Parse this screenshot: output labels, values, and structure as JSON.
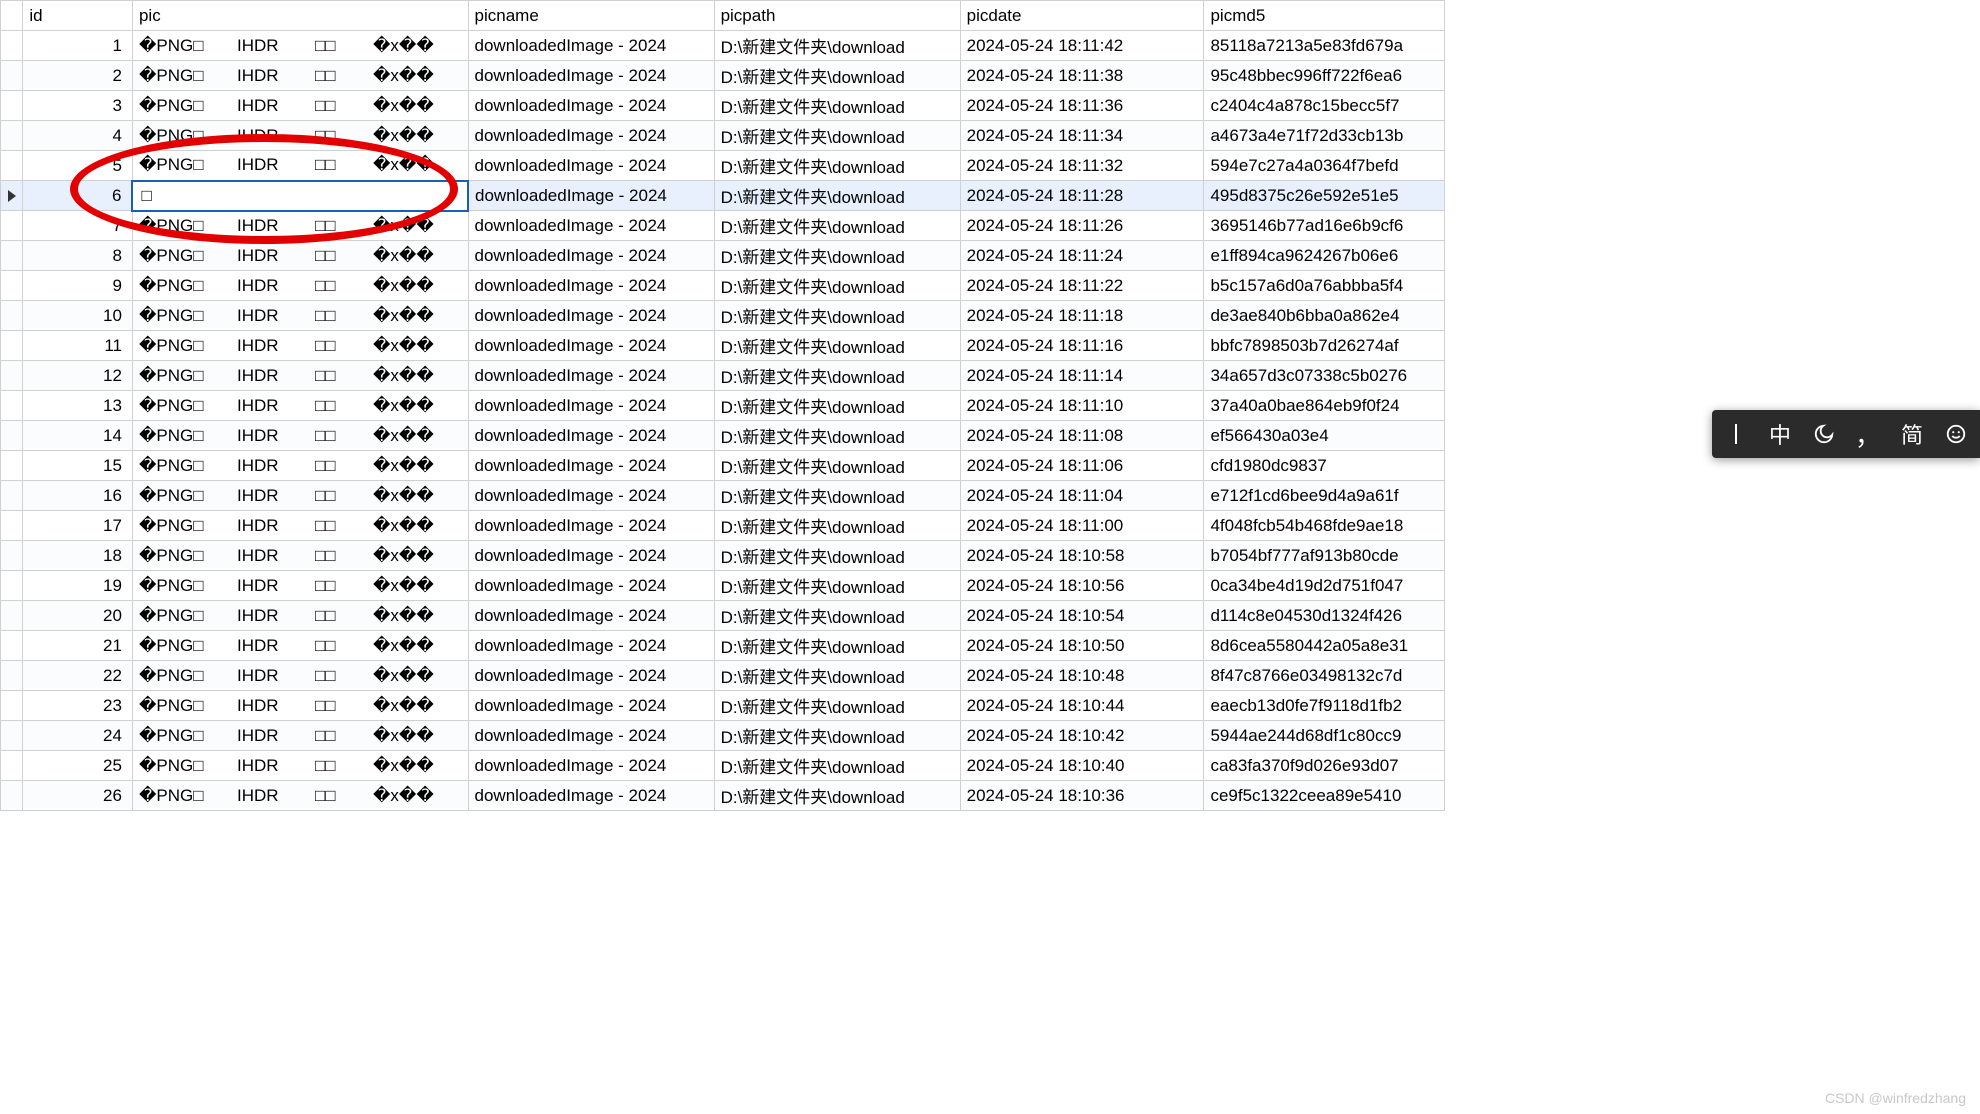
{
  "columns": {
    "id": "id",
    "pic": "pic",
    "picname": "picname",
    "picpath": "picpath",
    "picdate": "picdate",
    "picmd5": "picmd5"
  },
  "pic_content": {
    "p1": "�PNG□",
    "p2": "IHDR",
    "p3": "□□",
    "p4": "�x��"
  },
  "edit_value": "□",
  "picname_value": "downloadedImage - 2024",
  "picpath_value": "D:\\新建文件夹\\download",
  "rows": [
    {
      "id": "1",
      "picdate": "2024-05-24 18:11:42",
      "picmd5": "85118a7213a5e83fd679a"
    },
    {
      "id": "2",
      "picdate": "2024-05-24 18:11:38",
      "picmd5": "95c48bbec996ff722f6ea6"
    },
    {
      "id": "3",
      "picdate": "2024-05-24 18:11:36",
      "picmd5": "c2404c4a878c15becc5f7"
    },
    {
      "id": "4",
      "picdate": "2024-05-24 18:11:34",
      "picmd5": "a4673a4e71f72d33cb13b"
    },
    {
      "id": "5",
      "picdate": "2024-05-24 18:11:32",
      "picmd5": "594e7c27a4a0364f7befd"
    },
    {
      "id": "6",
      "picdate": "2024-05-24 18:11:28",
      "picmd5": "495d8375c26e592e51e5",
      "editing": true
    },
    {
      "id": "7",
      "picdate": "2024-05-24 18:11:26",
      "picmd5": "3695146b77ad16e6b9cf6"
    },
    {
      "id": "8",
      "picdate": "2024-05-24 18:11:24",
      "picmd5": "e1ff894ca9624267b06e6"
    },
    {
      "id": "9",
      "picdate": "2024-05-24 18:11:22",
      "picmd5": "b5c157a6d0a76abbba5f4"
    },
    {
      "id": "10",
      "picdate": "2024-05-24 18:11:18",
      "picmd5": "de3ae840b6bba0a862e4"
    },
    {
      "id": "11",
      "picdate": "2024-05-24 18:11:16",
      "picmd5": "bbfc7898503b7d26274af"
    },
    {
      "id": "12",
      "picdate": "2024-05-24 18:11:14",
      "picmd5": "34a657d3c07338c5b0276"
    },
    {
      "id": "13",
      "picdate": "2024-05-24 18:11:10",
      "picmd5": "37a40a0bae864eb9f0f24"
    },
    {
      "id": "14",
      "picdate": "2024-05-24 18:11:08",
      "picmd5": "ef566430a03e4"
    },
    {
      "id": "15",
      "picdate": "2024-05-24 18:11:06",
      "picmd5": "cfd1980dc9837"
    },
    {
      "id": "16",
      "picdate": "2024-05-24 18:11:04",
      "picmd5": "e712f1cd6bee9d4a9a61f"
    },
    {
      "id": "17",
      "picdate": "2024-05-24 18:11:00",
      "picmd5": "4f048fcb54b468fde9ae18"
    },
    {
      "id": "18",
      "picdate": "2024-05-24 18:10:58",
      "picmd5": "b7054bf777af913b80cde"
    },
    {
      "id": "19",
      "picdate": "2024-05-24 18:10:56",
      "picmd5": "0ca34be4d19d2d751f047"
    },
    {
      "id": "20",
      "picdate": "2024-05-24 18:10:54",
      "picmd5": "d114c8e04530d1324f426"
    },
    {
      "id": "21",
      "picdate": "2024-05-24 18:10:50",
      "picmd5": "8d6cea5580442a05a8e31"
    },
    {
      "id": "22",
      "picdate": "2024-05-24 18:10:48",
      "picmd5": "8f47c8766e03498132c7d"
    },
    {
      "id": "23",
      "picdate": "2024-05-24 18:10:44",
      "picmd5": "eaecb13d0fe7f9118d1fb2"
    },
    {
      "id": "24",
      "picdate": "2024-05-24 18:10:42",
      "picmd5": "5944ae244d68df1c80cc9"
    },
    {
      "id": "25",
      "picdate": "2024-05-24 18:10:40",
      "picmd5": "ca83fa370f9d026e93d07"
    },
    {
      "id": "26",
      "picdate": "2024-05-24 18:10:36",
      "picmd5": "ce9f5c1322ceea89e5410"
    }
  ],
  "ime": {
    "item1": "中",
    "item2": "，",
    "item3": "简"
  },
  "watermark": "CSDN @winfredzhang"
}
